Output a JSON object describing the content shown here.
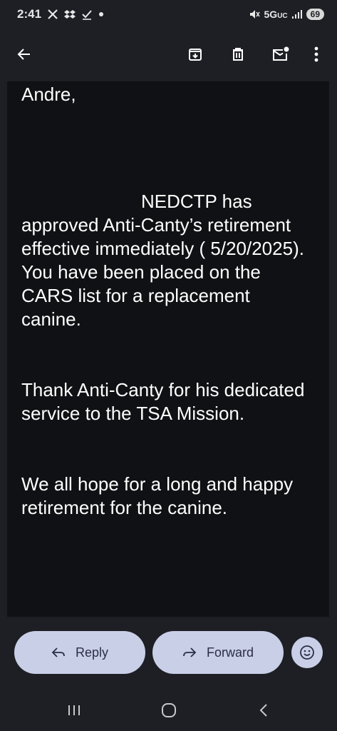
{
  "status_bar": {
    "time": "2:41",
    "network": "5G",
    "network_suffix": "UC",
    "battery": "69",
    "notification_icons": [
      "x-icon",
      "dropbox-icon",
      "checkmark-icon",
      "dot-icon"
    ]
  },
  "toolbar": {
    "icons": [
      "back-arrow-icon",
      "archive-icon",
      "delete-icon",
      "mark-unread-icon",
      "more-vert-icon"
    ]
  },
  "email": {
    "greeting": "Andre,",
    "paragraph1_lead": "NEDCTP has",
    "paragraph1_rest": "approved Anti-Canty’s retirement effective immediately ( 5/20/2025).  You have been placed on the CARS list for a replacement canine.",
    "paragraph2": "Thank Anti-Canty for his dedicated service to the TSA Mission.",
    "paragraph3": "We all hope for a long and happy retirement for the canine."
  },
  "actions": {
    "reply_label": "Reply",
    "forward_label": "Forward"
  },
  "colors": {
    "background": "#1e1f25",
    "email_background": "#101114",
    "pill": "#c9cfe6",
    "pill_text": "#2a2f45"
  }
}
